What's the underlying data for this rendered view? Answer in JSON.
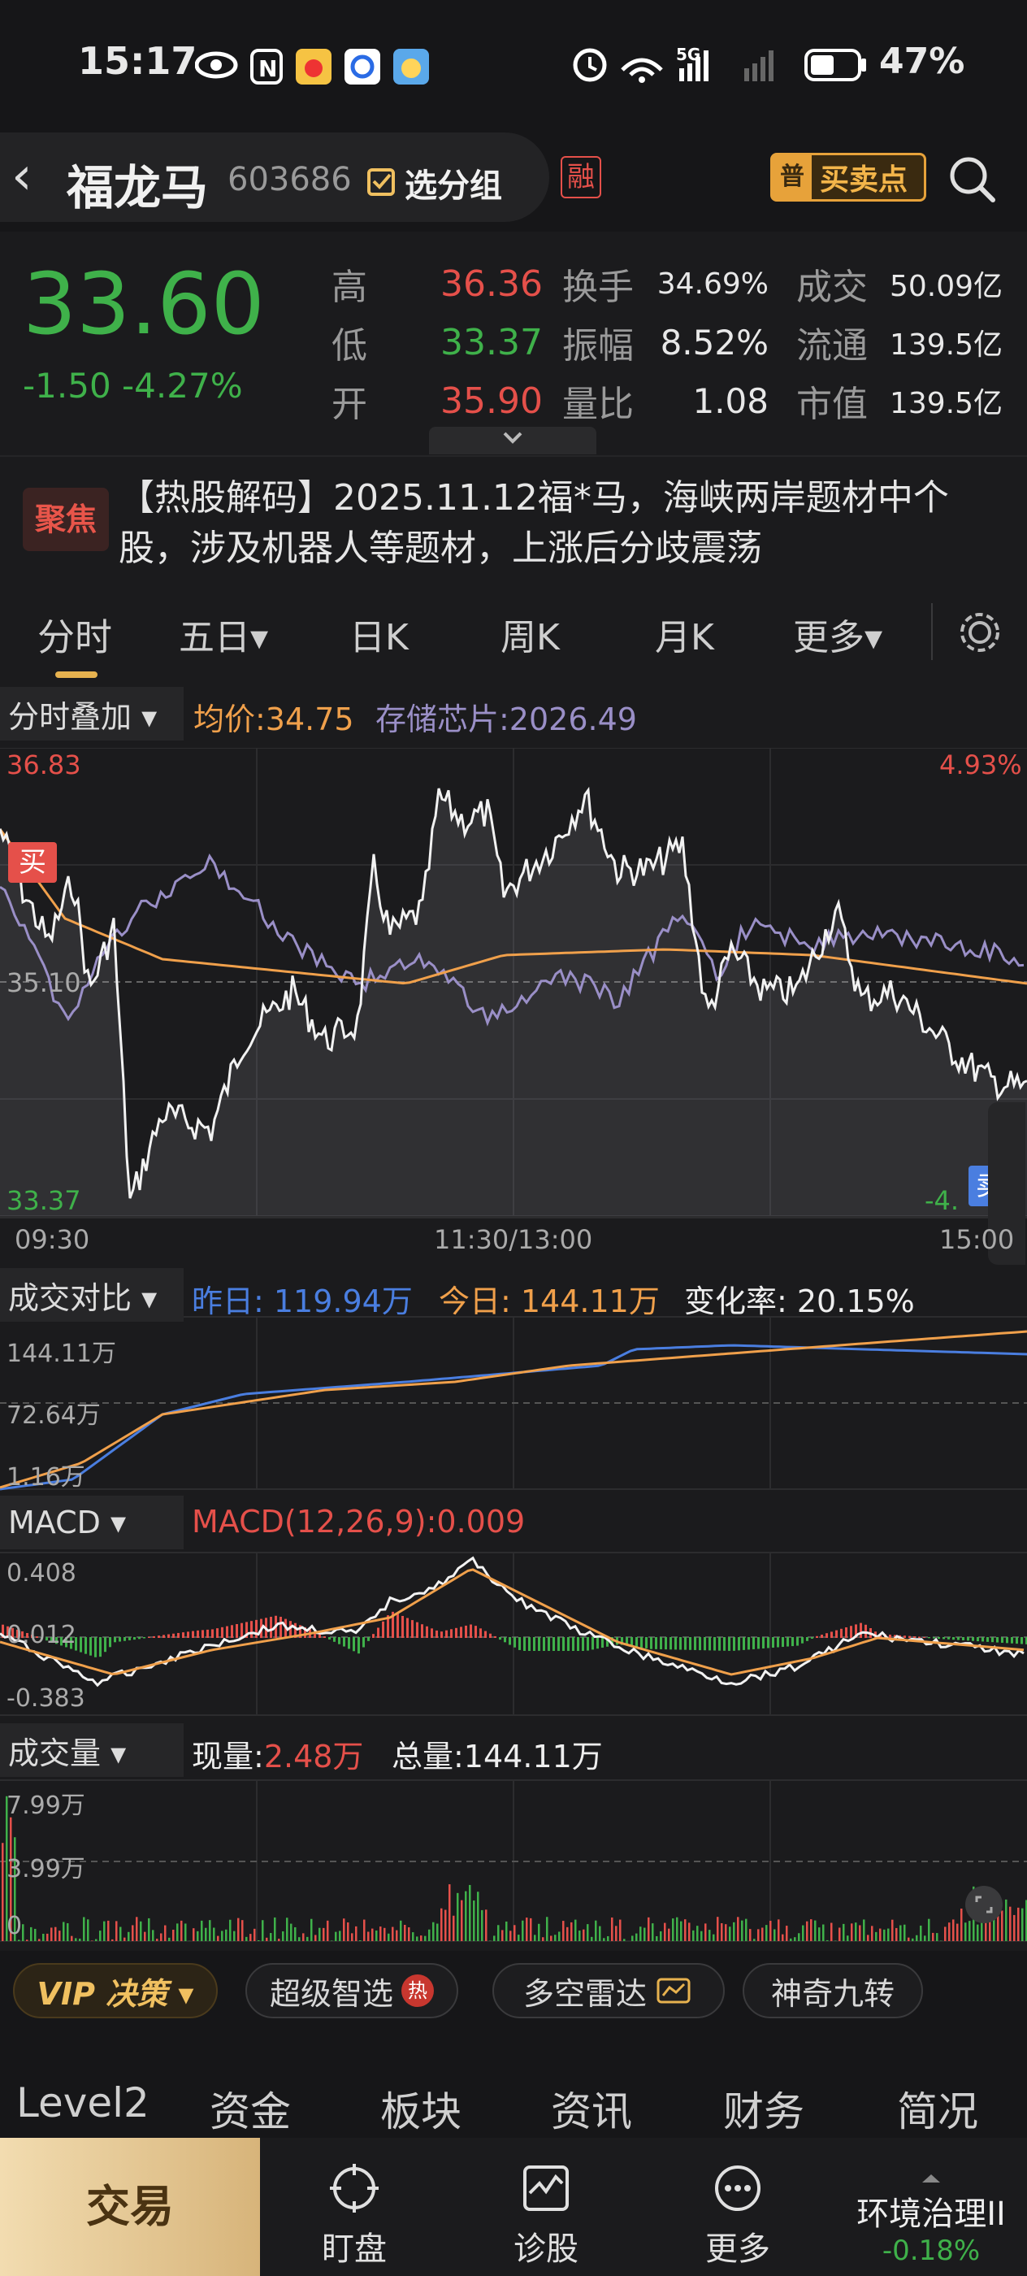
{
  "status_bar": {
    "time": "15:17",
    "network": "5G",
    "battery": "47%"
  },
  "header": {
    "back": "‹",
    "name": "福龙马",
    "code": "603686",
    "group_button": "选分组",
    "margin_badge": "融",
    "trade_point_badge": "普",
    "trade_point_label": "买卖点"
  },
  "quote": {
    "price": "33.60",
    "change": "-1.50",
    "change_pct": "-4.27%",
    "stats": [
      {
        "label": "高",
        "value": "36.36",
        "color": "red"
      },
      {
        "label": "低",
        "value": "33.37",
        "color": "green"
      },
      {
        "label": "开",
        "value": "35.90",
        "color": "red"
      }
    ],
    "stats2": [
      {
        "label": "换手",
        "value": "34.69%"
      },
      {
        "label": "振幅",
        "value": "8.52%"
      },
      {
        "label": "量比",
        "value": "1.08"
      }
    ],
    "stats3": [
      {
        "label": "成交",
        "value": "50.09亿"
      },
      {
        "label": "流通",
        "value": "139.5亿"
      },
      {
        "label": "市值",
        "value": "139.5亿"
      }
    ]
  },
  "news": {
    "badge": "聚焦",
    "text": "【热股解码】2025.11.12福*马，海峡两岸题材中个股，涉及机器人等题材，上涨后分歧震荡"
  },
  "tabs": [
    "分时",
    "五日▾",
    "日K",
    "周K",
    "月K",
    "更多▾"
  ],
  "intraday": {
    "overlay_label": "分时叠加 ▾",
    "avg_label": "均价:34.75",
    "overlay_index": "存储芯片:2026.49",
    "y_high": "36.83",
    "y_mid": "35.10",
    "y_low": "33.37",
    "pct_high": "4.93%",
    "pct_low": "-4.",
    "buy_tag": "买",
    "sell_tag": "卖",
    "x_start": "09:30",
    "x_mid": "11:30/13:00",
    "x_end": "15:00"
  },
  "compare": {
    "label": "成交对比 ▾",
    "yesterday": "昨日: 119.94万",
    "today": "今日: 144.11万",
    "change": "变化率: 20.15%",
    "y_high": "144.11万",
    "y_mid": "72.64万",
    "y_low": "1.16万"
  },
  "macd": {
    "label": "MACD ▾",
    "title": "MACD(12,26,9):0.009",
    "y_high": "0.408",
    "y_mid": "0.012",
    "y_low": "-0.383"
  },
  "volume": {
    "label": "成交量 ▾",
    "now_label": "现量:",
    "now_value": "2.48万",
    "total": "总量:144.11万",
    "y_high": "7.99万",
    "y_mid": "3.99万",
    "y_low": "0"
  },
  "tools": {
    "vip": "VIP 决策 ▾",
    "chips": [
      "超级智选",
      "多空雷达",
      "神奇九转"
    ],
    "hot": "热"
  },
  "bottom_tabs": [
    "Level2",
    "资金",
    "板块",
    "资讯",
    "财务",
    "简况"
  ],
  "nav": {
    "trade": "交易",
    "items": [
      "盯盘",
      "诊股",
      "更多"
    ],
    "index_name": "环境治理II",
    "index_change": "-0.18%"
  },
  "colors": {
    "red": "#e5504a",
    "green": "#3fb14a",
    "gold": "#e7b24f",
    "purple": "#9a8fc7",
    "orange": "#f0a04b",
    "blue": "#4a7ee0"
  }
}
